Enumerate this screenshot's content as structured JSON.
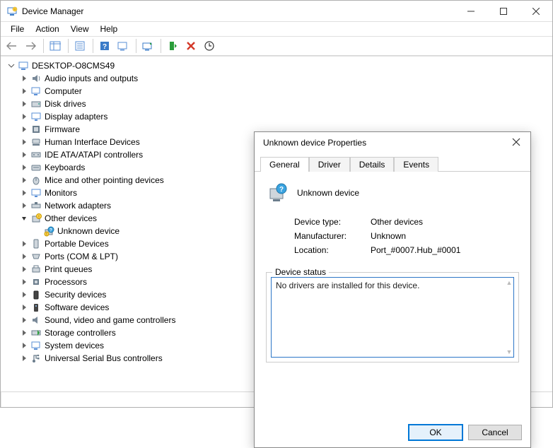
{
  "window": {
    "title": "Device Manager"
  },
  "menu": {
    "file": "File",
    "action": "Action",
    "view": "View",
    "help": "Help"
  },
  "tree": {
    "root": "DESKTOP-O8CMS49",
    "items": [
      "Audio inputs and outputs",
      "Computer",
      "Disk drives",
      "Display adapters",
      "Firmware",
      "Human Interface Devices",
      "IDE ATA/ATAPI controllers",
      "Keyboards",
      "Mice and other pointing devices",
      "Monitors",
      "Network adapters",
      "Other devices",
      "Portable Devices",
      "Ports (COM & LPT)",
      "Print queues",
      "Processors",
      "Security devices",
      "Software devices",
      "Sound, video and game controllers",
      "Storage controllers",
      "System devices",
      "Universal Serial Bus controllers"
    ],
    "other_child": "Unknown device"
  },
  "dialog": {
    "title": "Unknown device Properties",
    "tabs": {
      "general": "General",
      "driver": "Driver",
      "details": "Details",
      "events": "Events"
    },
    "device_name": "Unknown device",
    "labels": {
      "type": "Device type:",
      "mfr": "Manufacturer:",
      "loc": "Location:",
      "status_legend": "Device status"
    },
    "values": {
      "type": "Other devices",
      "mfr": "Unknown",
      "loc": "Port_#0007.Hub_#0001"
    },
    "status_text": "No drivers are installed for this device.",
    "buttons": {
      "ok": "OK",
      "cancel": "Cancel"
    }
  }
}
